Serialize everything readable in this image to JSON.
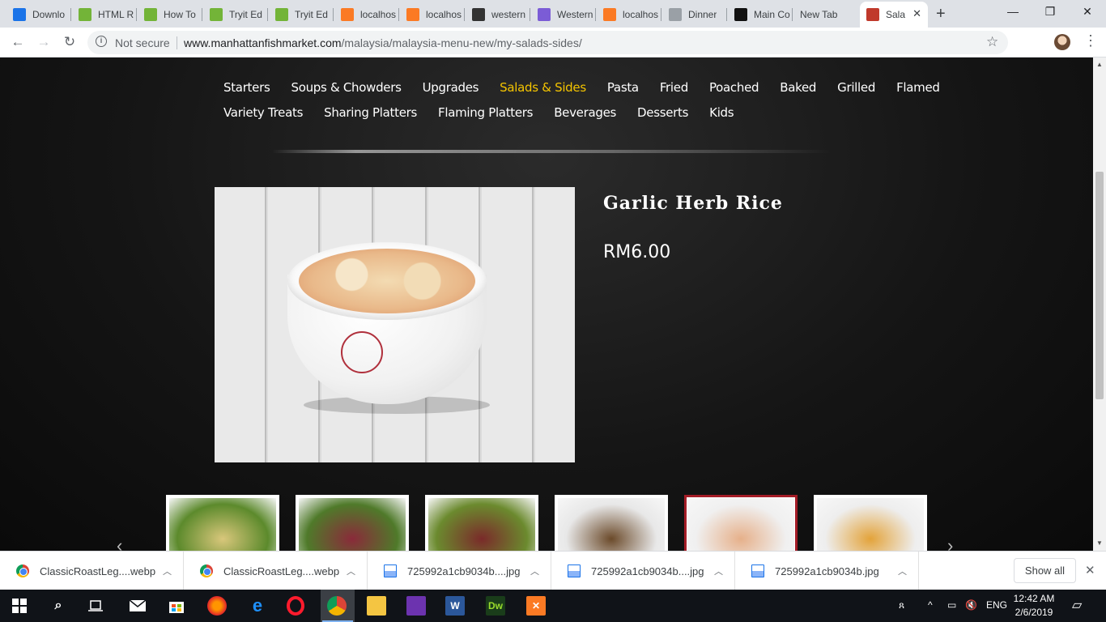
{
  "browser": {
    "tabs": [
      {
        "title": "Downlo",
        "icon": "download-icon",
        "color": "#1a73e8"
      },
      {
        "title": "HTML R",
        "icon": "w3schools-icon",
        "color": "#73b438"
      },
      {
        "title": "How To",
        "icon": "w3schools-icon",
        "color": "#73b438"
      },
      {
        "title": "Tryit Ed",
        "icon": "w3schools-icon",
        "color": "#73b438"
      },
      {
        "title": "Tryit Ed",
        "icon": "w3schools-icon",
        "color": "#73b438"
      },
      {
        "title": "localhos",
        "icon": "xampp-icon",
        "color": "#fb7a24"
      },
      {
        "title": "localhos",
        "icon": "xampp-icon",
        "color": "#fb7a24"
      },
      {
        "title": "western",
        "icon": "site-icon",
        "color": "#333333"
      },
      {
        "title": "Western",
        "icon": "play-icon",
        "color": "#7b5cd6"
      },
      {
        "title": "localhos",
        "icon": "xampp-icon",
        "color": "#fb7a24"
      },
      {
        "title": "Dinner",
        "icon": "document-icon",
        "color": "#9aa0a6"
      },
      {
        "title": "Main Co",
        "icon": "s-logo-icon",
        "color": "#111111"
      },
      {
        "title": "New Tab",
        "icon": "",
        "color": ""
      },
      {
        "title": "Sala",
        "icon": "fishmarket-icon",
        "color": "#c0392b"
      }
    ],
    "new_tab_symbol": "+",
    "window_controls": {
      "minimize": "—",
      "maximize": "❐",
      "close": "✕"
    },
    "omnibox": {
      "security_label": "Not secure",
      "url_host": "www.manhattanfishmarket.com",
      "url_path": "/malaysia/malaysia-menu-new/my-salads-sides/"
    }
  },
  "page": {
    "categories_row1": [
      "Starters",
      "Soups & Chowders",
      "Upgrades",
      "Salads & Sides",
      "Pasta",
      "Fried",
      "Poached",
      "Baked",
      "Grilled",
      "Flamed"
    ],
    "categories_row2": [
      "Variety Treats",
      "Sharing Platters",
      "Flaming Platters",
      "Beverages",
      "Desserts",
      "Kids"
    ],
    "active_category": "Salads & Sides",
    "product": {
      "name": "Garlic Herb Rice",
      "price": "RM6.00"
    },
    "thumbnails": [
      {
        "name": "caesar-salad",
        "colors": [
          "#5c8a2c",
          "#d9c77b"
        ]
      },
      {
        "name": "garden-salad",
        "colors": [
          "#4f7a2a",
          "#8a2a3a"
        ]
      },
      {
        "name": "beef-salad",
        "colors": [
          "#6b8a2e",
          "#7a2a2a"
        ]
      },
      {
        "name": "mushroom-soup-bowl",
        "colors": [
          "#e8e8e8",
          "#6b4a2a"
        ]
      },
      {
        "name": "garlic-herb-rice",
        "colors": [
          "#f0f0f0",
          "#e6b08a"
        ],
        "active": true
      },
      {
        "name": "french-fries",
        "colors": [
          "#eeeeee",
          "#e3a33a"
        ]
      }
    ],
    "accent_color": "#f4c400",
    "active_thumb_border": "#a31c26"
  },
  "downloads": {
    "items": [
      {
        "name": "ClassicRoastLeg....webp",
        "type": "chrome"
      },
      {
        "name": "ClassicRoastLeg....webp",
        "type": "chrome"
      },
      {
        "name": "725992a1cb9034b....jpg",
        "type": "img"
      },
      {
        "name": "725992a1cb9034b....jpg",
        "type": "img"
      },
      {
        "name": "725992a1cb9034b.jpg",
        "type": "img"
      }
    ],
    "show_all_label": "Show all"
  },
  "taskbar": {
    "language": "ENG",
    "time": "12:42 AM",
    "date": "2/6/2019"
  }
}
